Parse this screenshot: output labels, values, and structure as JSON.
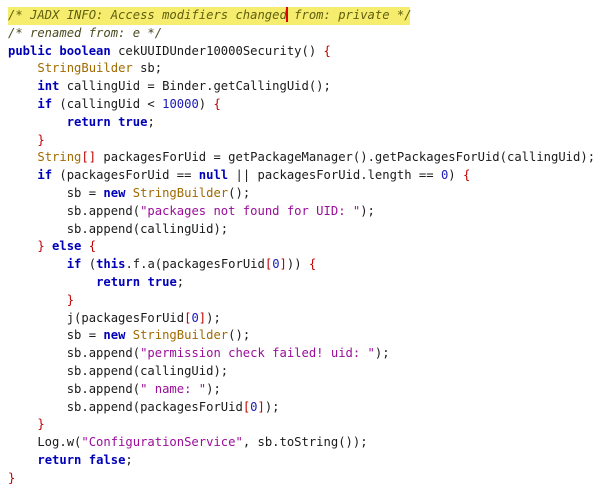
{
  "editor": {
    "comment_part1": "/* JADX INFO: Access modifiers changed",
    "comment_part2": " from: private */",
    "lines": [
      [
        [
          "cmt2",
          "/* renamed from: e */"
        ]
      ],
      [
        [
          "kw",
          "public"
        ],
        [
          "plain",
          " "
        ],
        [
          "kw",
          "boolean"
        ],
        [
          "plain",
          " cekUUIDUnder10000Security() "
        ],
        [
          "br",
          "{"
        ]
      ],
      [
        [
          "plain",
          "    "
        ],
        [
          "type",
          "StringBuilder"
        ],
        [
          "plain",
          " sb;"
        ]
      ],
      [
        [
          "plain",
          "    "
        ],
        [
          "kw",
          "int"
        ],
        [
          "plain",
          " callingUid = Binder.getCallingUid();"
        ]
      ],
      [
        [
          "plain",
          "    "
        ],
        [
          "kw",
          "if"
        ],
        [
          "plain",
          " (callingUid < "
        ],
        [
          "num",
          "10000"
        ],
        [
          "plain",
          ") "
        ],
        [
          "br",
          "{"
        ]
      ],
      [
        [
          "plain",
          "        "
        ],
        [
          "kw",
          "return"
        ],
        [
          "plain",
          " "
        ],
        [
          "kw",
          "true"
        ],
        [
          "plain",
          ";"
        ]
      ],
      [
        [
          "plain",
          "    "
        ],
        [
          "br",
          "}"
        ]
      ],
      [
        [
          "plain",
          "    "
        ],
        [
          "type",
          "String"
        ],
        [
          "br",
          "[]"
        ],
        [
          "plain",
          " packagesForUid = getPackageManager().getPackagesForUid(callingUid);"
        ]
      ],
      [
        [
          "plain",
          "    "
        ],
        [
          "kw",
          "if"
        ],
        [
          "plain",
          " (packagesForUid == "
        ],
        [
          "kw",
          "null"
        ],
        [
          "plain",
          " || packagesForUid.length == "
        ],
        [
          "num",
          "0"
        ],
        [
          "plain",
          ") "
        ],
        [
          "br",
          "{"
        ]
      ],
      [
        [
          "plain",
          "        sb = "
        ],
        [
          "kw",
          "new"
        ],
        [
          "plain",
          " "
        ],
        [
          "type",
          "StringBuilder"
        ],
        [
          "plain",
          "();"
        ]
      ],
      [
        [
          "plain",
          "        sb.append("
        ],
        [
          "str",
          "\"packages not found for UID: \""
        ],
        [
          "plain",
          ");"
        ]
      ],
      [
        [
          "plain",
          "        sb.append(callingUid);"
        ]
      ],
      [
        [
          "plain",
          "    "
        ],
        [
          "br",
          "}"
        ],
        [
          "plain",
          " "
        ],
        [
          "kw",
          "else"
        ],
        [
          "plain",
          " "
        ],
        [
          "br",
          "{"
        ]
      ],
      [
        [
          "plain",
          "        "
        ],
        [
          "kw",
          "if"
        ],
        [
          "plain",
          " ("
        ],
        [
          "kw",
          "this"
        ],
        [
          "plain",
          ".f.a(packagesForUid"
        ],
        [
          "br",
          "["
        ],
        [
          "num",
          "0"
        ],
        [
          "br",
          "]"
        ],
        [
          "plain",
          ")) "
        ],
        [
          "br",
          "{"
        ]
      ],
      [
        [
          "plain",
          "            "
        ],
        [
          "kw",
          "return"
        ],
        [
          "plain",
          " "
        ],
        [
          "kw",
          "true"
        ],
        [
          "plain",
          ";"
        ]
      ],
      [
        [
          "plain",
          "        "
        ],
        [
          "br",
          "}"
        ]
      ],
      [
        [
          "plain",
          "        j(packagesForUid"
        ],
        [
          "br",
          "["
        ],
        [
          "num",
          "0"
        ],
        [
          "br",
          "]"
        ],
        [
          "plain",
          ");"
        ]
      ],
      [
        [
          "plain",
          "        sb = "
        ],
        [
          "kw",
          "new"
        ],
        [
          "plain",
          " "
        ],
        [
          "type",
          "StringBuilder"
        ],
        [
          "plain",
          "();"
        ]
      ],
      [
        [
          "plain",
          "        sb.append("
        ],
        [
          "str",
          "\"permission check failed! uid: \""
        ],
        [
          "plain",
          ");"
        ]
      ],
      [
        [
          "plain",
          "        sb.append(callingUid);"
        ]
      ],
      [
        [
          "plain",
          "        sb.append("
        ],
        [
          "str",
          "\" name: \""
        ],
        [
          "plain",
          ");"
        ]
      ],
      [
        [
          "plain",
          "        sb.append(packagesForUid"
        ],
        [
          "br",
          "["
        ],
        [
          "num",
          "0"
        ],
        [
          "br",
          "]"
        ],
        [
          "plain",
          ");"
        ]
      ],
      [
        [
          "plain",
          "    "
        ],
        [
          "br",
          "}"
        ]
      ],
      [
        [
          "plain",
          "    Log.w("
        ],
        [
          "str",
          "\"ConfigurationService\""
        ],
        [
          "plain",
          ", sb.toString());"
        ]
      ],
      [
        [
          "plain",
          "    "
        ],
        [
          "kw",
          "return"
        ],
        [
          "plain",
          " "
        ],
        [
          "kw",
          "false"
        ],
        [
          "plain",
          ";"
        ]
      ],
      [
        [
          "br",
          "}"
        ]
      ]
    ]
  }
}
